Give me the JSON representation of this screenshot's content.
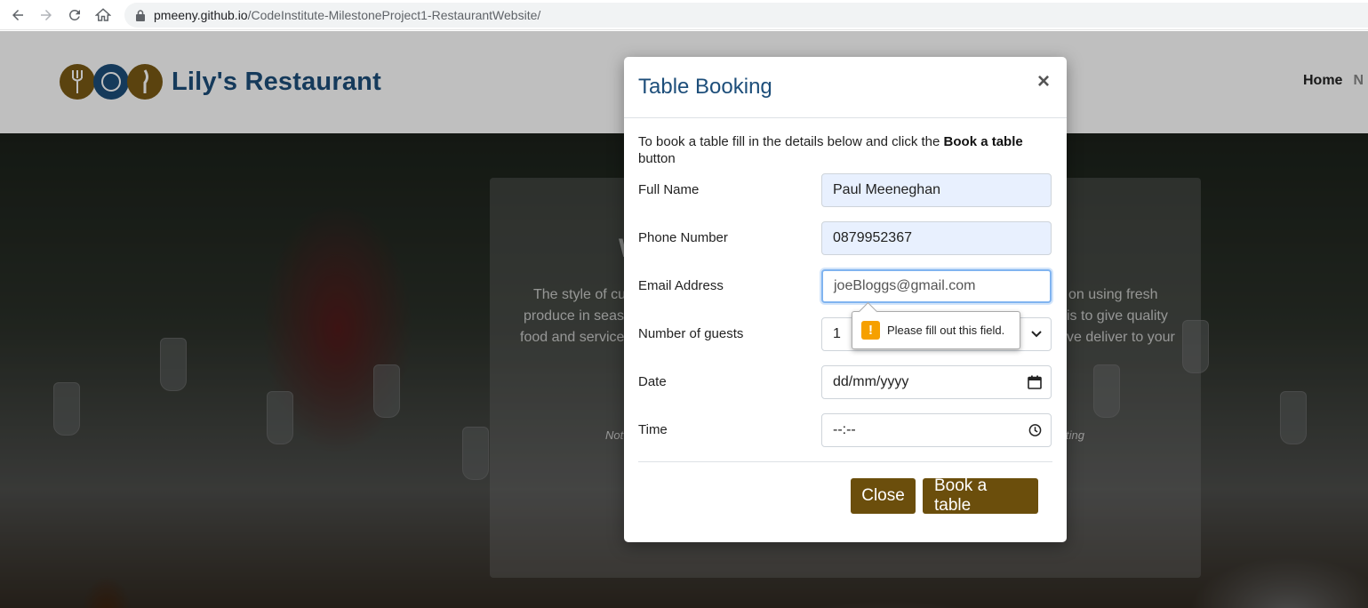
{
  "browser": {
    "url_host": "pmeeny.github.io",
    "url_path": "/CodeInstitute-MilestoneProject1-RestaurantWebsite/"
  },
  "site": {
    "brand": "Lily's Restaurant",
    "nav": {
      "home": "Home",
      "next": "N"
    }
  },
  "hero": {
    "peek_left_1": "The style of cu",
    "peek_left_2": "produce in seaso",
    "peek_left_3": "food and service",
    "peek_right_1": "on using fresh",
    "peek_right_2": "is to give quality",
    "peek_right_3": "ve deliver to your",
    "peek_heading_left": "W",
    "peek_italic_left": "Not",
    "peek_italic_right": "ting"
  },
  "modal": {
    "title": "Table Booking",
    "close_symbol": "×",
    "intro_text": "To book a table fill in the details below and click the ",
    "intro_bold": "Book a table",
    "intro_tail": " button",
    "fields": {
      "full_name": {
        "label": "Full Name",
        "value": "Paul Meeneghan"
      },
      "phone": {
        "label": "Phone Number",
        "value": "0879952367"
      },
      "email": {
        "label": "Email Address",
        "placeholder": "joeBloggs@gmail.com"
      },
      "guests": {
        "label": "Number of guests",
        "value": "1"
      },
      "date": {
        "label": "Date",
        "placeholder": "dd/mm/yyyy"
      },
      "time": {
        "label": "Time",
        "placeholder": "--:--"
      }
    },
    "close_button": "Close",
    "book_button": "Book a table"
  },
  "validation": {
    "message": "Please fill out this field.",
    "icon": "!"
  },
  "colors": {
    "brand_blue": "#1d4e7a",
    "brand_brown": "#6b4e0c",
    "autofill": "#e8f0fe",
    "warning": "#f6a000"
  }
}
